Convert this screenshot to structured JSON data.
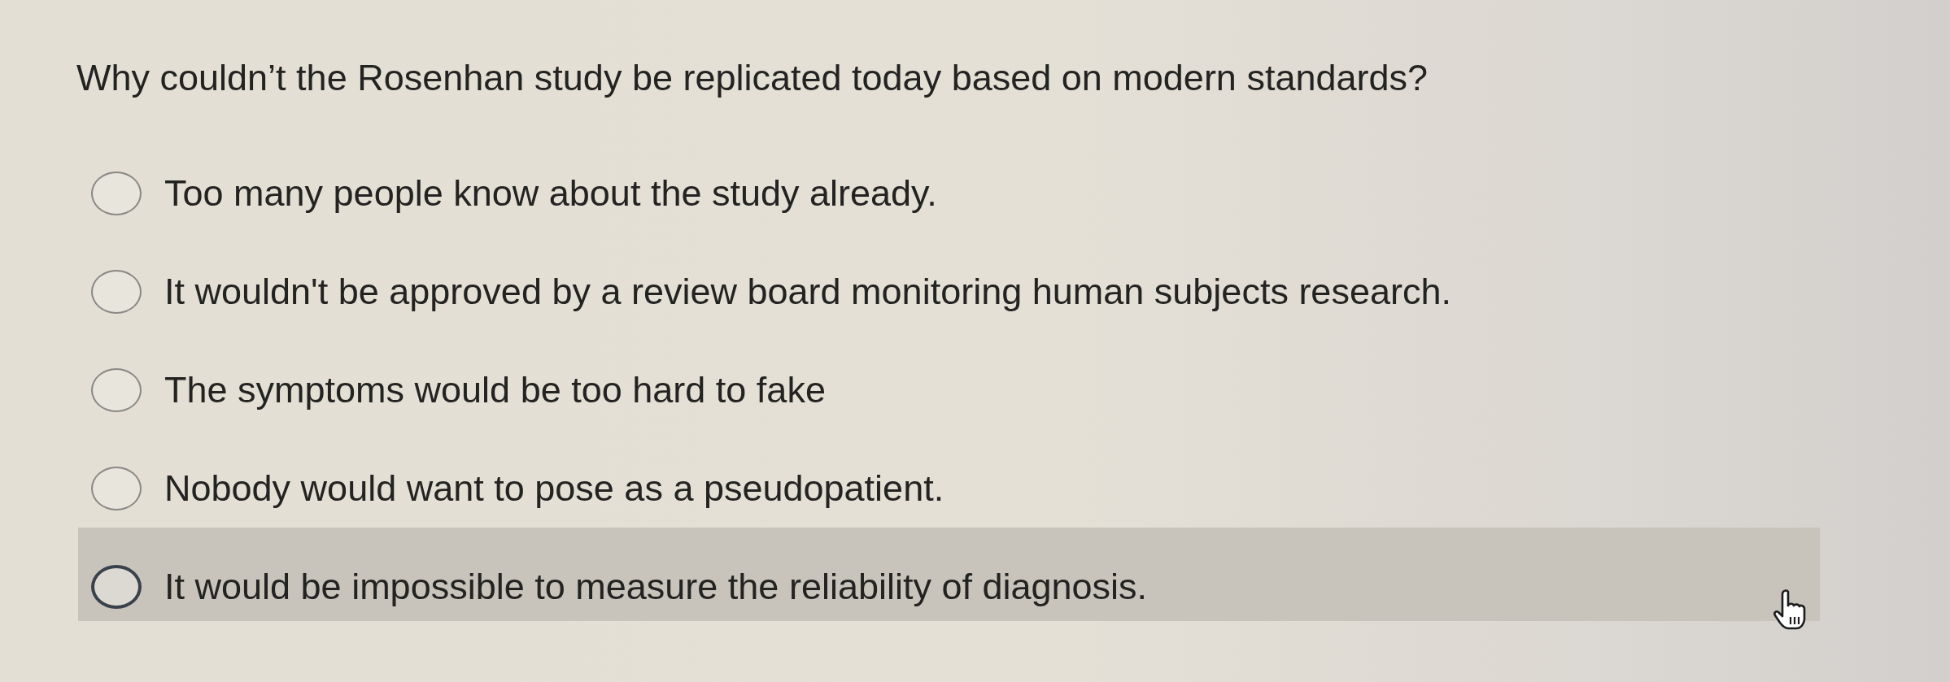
{
  "question": {
    "text": "Why couldn’t the Rosenhan study be replicated today based on modern standards?"
  },
  "options": [
    {
      "label": "Too many people know about the study already.",
      "selected": false,
      "hovered": false
    },
    {
      "label": "It wouldn't be approved by a review board monitoring human subjects research.",
      "selected": false,
      "hovered": false
    },
    {
      "label": "The symptoms would be too hard to fake",
      "selected": false,
      "hovered": false
    },
    {
      "label": "Nobody would want to pose as a pseudopatient.",
      "selected": false,
      "hovered": false
    },
    {
      "label": "It would be impossible to measure the reliability of diagnosis.",
      "selected": false,
      "hovered": true
    }
  ]
}
